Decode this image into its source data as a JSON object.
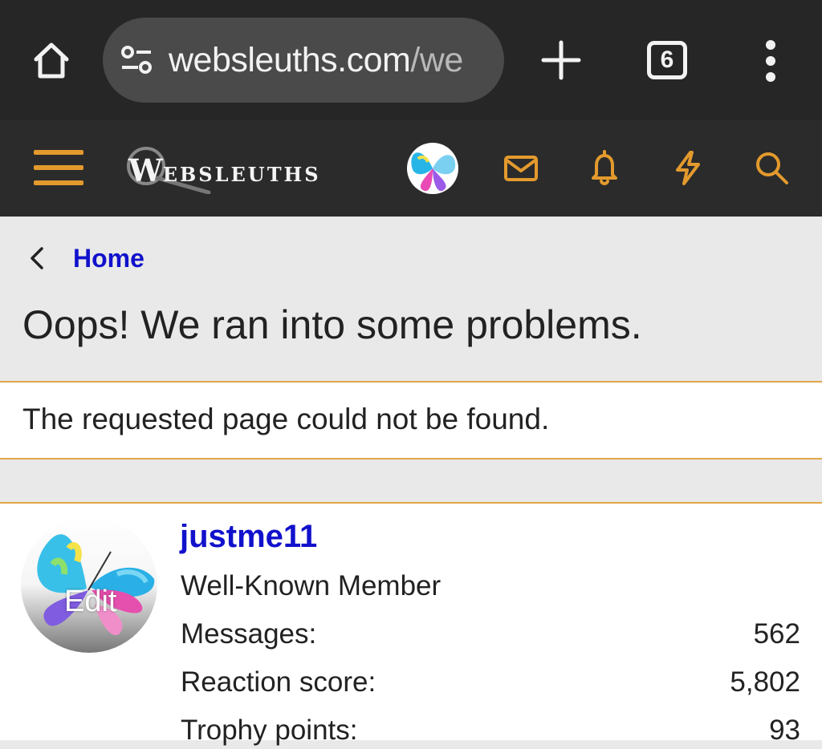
{
  "browser": {
    "url_domain": "websleuths.com",
    "url_path": "/we",
    "tab_count": "6"
  },
  "site": {
    "logo_text": "WEBSLEUTHS",
    "colors": {
      "accent": "#e39a2d",
      "link": "#1111cc",
      "header_bg": "#2b2b2b",
      "browser_bg": "#262626"
    },
    "header_icons": [
      "menu-icon",
      "avatar",
      "mail-icon",
      "bell-icon",
      "lightning-icon",
      "search-icon"
    ]
  },
  "breadcrumb": {
    "home_label": "Home"
  },
  "page": {
    "title": "Oops! We ran into some problems.",
    "message": "The requested page could not be found."
  },
  "profile": {
    "edit_label": "Edit",
    "username": "justme11",
    "title": "Well-Known Member",
    "stats": [
      {
        "label": "Messages:",
        "value": "562"
      },
      {
        "label": "Reaction score:",
        "value": "5,802"
      },
      {
        "label": "Trophy points:",
        "value": "93"
      }
    ]
  }
}
